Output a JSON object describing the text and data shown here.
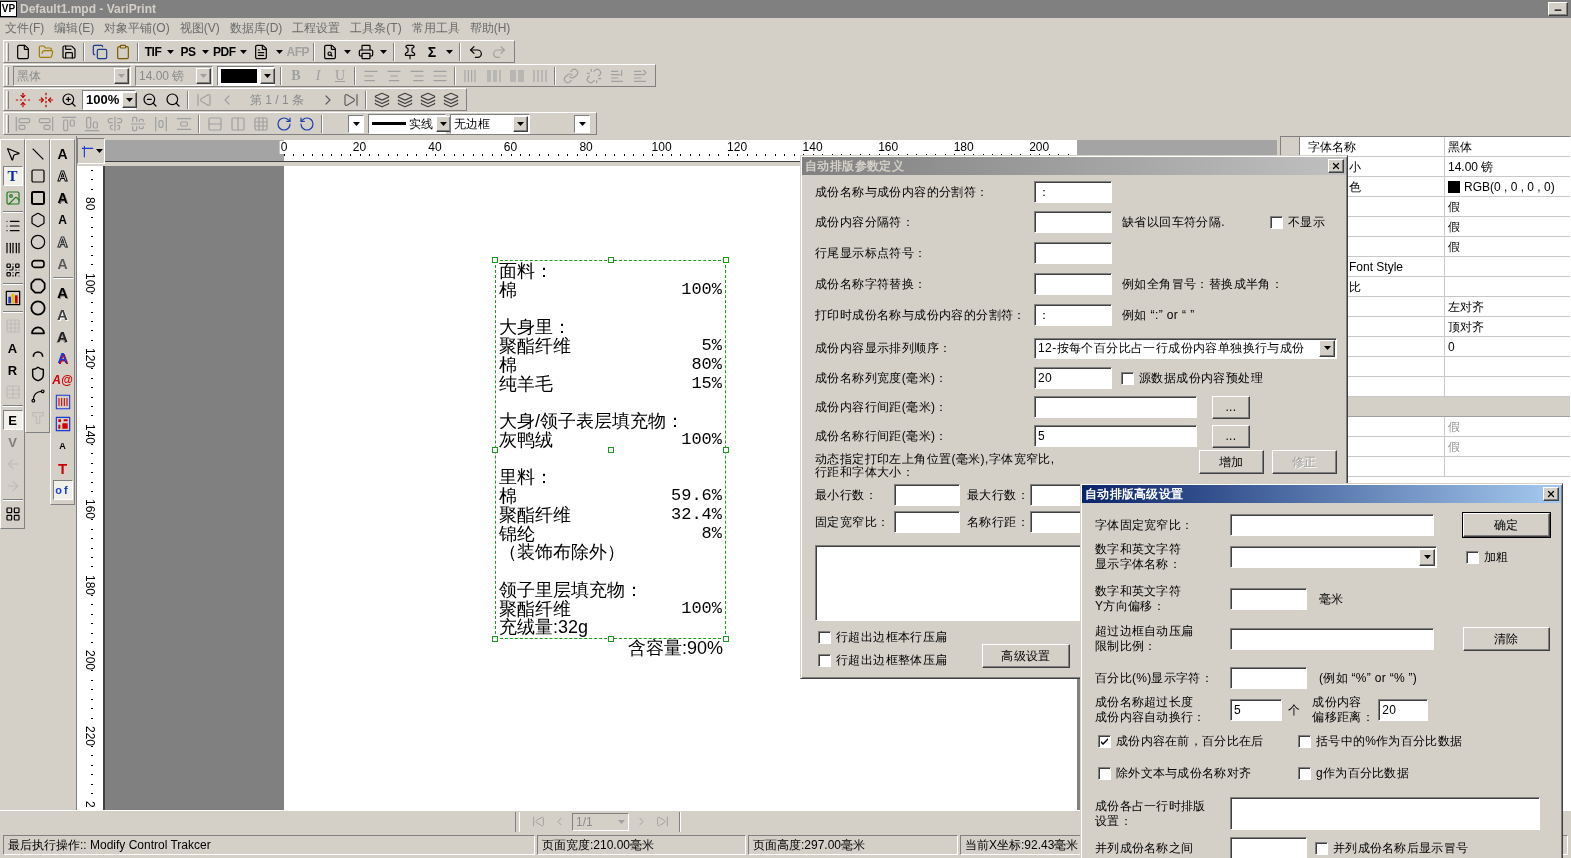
{
  "window": {
    "badge": "VP",
    "title": "Default1.mpd - VariPrint"
  },
  "menu": [
    "文件(F)",
    "编辑(E)",
    "对象平铺(O)",
    "视图(V)",
    "数据库(D)",
    "工程设置",
    "工具条(T)",
    "常用工具",
    "帮助(H)"
  ],
  "toolbars": [
    [
      [
        {
          "kind": "icon",
          "disabled": false
        },
        {
          "kind": "icon",
          "disabled": false
        },
        {
          "kind": "icon",
          "disabled": false
        }
      ],
      [
        {
          "kind": "icon",
          "disabled": false
        },
        {
          "kind": "icon",
          "disabled": false
        }
      ],
      [
        {
          "kind": "label",
          "text": "TIF",
          "disabled": false
        },
        {
          "kind": "caret",
          "disabled": false
        },
        {
          "kind": "label",
          "text": "PS",
          "disabled": false
        },
        {
          "kind": "caret",
          "disabled": false
        },
        {
          "kind": "label",
          "text": "PDF",
          "disabled": false
        },
        {
          "kind": "caret",
          "disabled": false
        },
        {
          "kind": "icon",
          "disabled": false
        },
        {
          "kind": "caret",
          "disabled": false
        },
        {
          "kind": "label",
          "text": "AFP",
          "disabled": true
        }
      ],
      [
        {
          "kind": "icon",
          "disabled": false
        },
        {
          "kind": "caret",
          "disabled": false
        },
        {
          "kind": "icon",
          "disabled": false
        },
        {
          "kind": "caret",
          "disabled": false
        }
      ],
      [
        {
          "kind": "icon",
          "disabled": false
        },
        {
          "kind": "label",
          "text": "Σ",
          "disabled": false
        },
        {
          "kind": "caret",
          "disabled": false
        }
      ],
      [
        {
          "kind": "icon",
          "disabled": false
        },
        {
          "kind": "icon",
          "disabled": true
        }
      ]
    ],
    [
      [
        {
          "kind": "combo",
          "value": "黑体",
          "disabled": true
        },
        {
          "kind": "combo",
          "value": "14.00 镑",
          "disabled": true
        },
        {
          "kind": "color_combo",
          "color": "#000000",
          "disabled": false
        }
      ],
      [
        {
          "kind": "label",
          "text": "B",
          "disabled": true
        },
        {
          "kind": "label",
          "text": "I",
          "disabled": true
        },
        {
          "kind": "label",
          "text": "U",
          "disabled": true
        }
      ],
      [
        {
          "kind": "icon",
          "disabled": true
        },
        {
          "kind": "icon",
          "disabled": true
        },
        {
          "kind": "icon",
          "disabled": true
        },
        {
          "kind": "icon",
          "disabled": true
        }
      ],
      [
        {
          "kind": "icon",
          "disabled": true
        },
        {
          "kind": "icon",
          "disabled": true
        },
        {
          "kind": "icon",
          "disabled": true
        },
        {
          "kind": "icon",
          "disabled": true
        }
      ],
      [
        {
          "kind": "icon",
          "disabled": true
        },
        {
          "kind": "icon",
          "disabled": true
        },
        {
          "kind": "icon",
          "disabled": true
        },
        {
          "kind": "icon",
          "disabled": true
        }
      ]
    ],
    [
      [
        {
          "kind": "icon",
          "disabled": false
        },
        {
          "kind": "icon",
          "disabled": false
        },
        {
          "kind": "icon",
          "disabled": false
        },
        {
          "kind": "combo",
          "value": "100%",
          "disabled": false
        },
        {
          "kind": "icon",
          "disabled": false
        },
        {
          "kind": "icon",
          "disabled": false
        }
      ],
      [
        {
          "kind": "icon",
          "disabled": true
        },
        {
          "kind": "icon",
          "disabled": true
        },
        {
          "kind": "text",
          "text": "第 1 / 1 条",
          "disabled": true
        },
        {
          "kind": "icon",
          "disabled": false
        },
        {
          "kind": "icon",
          "disabled": false
        }
      ],
      [
        {
          "kind": "icon",
          "disabled": false
        },
        {
          "kind": "icon",
          "disabled": false
        },
        {
          "kind": "icon",
          "disabled": false
        },
        {
          "kind": "icon",
          "disabled": false
        }
      ]
    ],
    [
      [
        {
          "kind": "icon",
          "disabled": true
        },
        {
          "kind": "icon",
          "disabled": true
        },
        {
          "kind": "icon",
          "disabled": true
        },
        {
          "kind": "icon",
          "disabled": true
        },
        {
          "kind": "icon",
          "disabled": true
        },
        {
          "kind": "icon",
          "disabled": true
        },
        {
          "kind": "icon",
          "disabled": true
        },
        {
          "kind": "icon",
          "disabled": true
        }
      ],
      [
        {
          "kind": "icon",
          "disabled": true
        },
        {
          "kind": "icon",
          "disabled": true
        },
        {
          "kind": "icon",
          "disabled": true
        },
        {
          "kind": "icon",
          "disabled": false
        },
        {
          "kind": "icon",
          "disabled": false
        }
      ],
      [
        {
          "kind": "combo",
          "disabled": false
        },
        {
          "kind": "line_combo",
          "value": "实线",
          "disabled": false
        },
        {
          "kind": "combo",
          "value": "无边框",
          "disabled": false
        },
        {
          "kind": "combo",
          "disabled": false
        }
      ]
    ]
  ],
  "tool_palettes": [
    [
      [
        {
          "kind": "icon",
          "selected": false,
          "disabled": false
        },
        {
          "kind": "glyph",
          "text": "T",
          "selected": true,
          "disabled": false
        },
        {
          "kind": "icon",
          "selected": false,
          "disabled": false
        }
      ],
      [
        {
          "kind": "icon",
          "selected": false,
          "disabled": false
        },
        {
          "kind": "icon",
          "selected": false,
          "disabled": false
        },
        {
          "kind": "icon",
          "selected": false,
          "disabled": false
        }
      ],
      [
        {
          "kind": "icon",
          "selected": false,
          "disabled": false
        }
      ],
      [
        {
          "kind": "icon",
          "selected": false,
          "disabled": true
        },
        {
          "kind": "glyph",
          "text": "A",
          "selected": false,
          "disabled": false
        },
        {
          "kind": "glyph",
          "text": "R",
          "selected": false,
          "disabled": false
        },
        {
          "kind": "icon",
          "selected": false,
          "disabled": true
        }
      ],
      [
        {
          "kind": "glyph",
          "text": "E",
          "selected": true,
          "disabled": false
        },
        {
          "kind": "glyph",
          "text": "V",
          "selected": false,
          "disabled": true
        },
        {
          "kind": "icon",
          "selected": false,
          "disabled": true
        },
        {
          "kind": "icon",
          "selected": false,
          "disabled": true
        }
      ],
      [
        {
          "kind": "icon",
          "selected": false,
          "disabled": false
        }
      ]
    ],
    [
      [
        {
          "kind": "icon",
          "selected": false,
          "disabled": false
        },
        {
          "kind": "icon",
          "selected": false,
          "disabled": false
        },
        {
          "kind": "icon",
          "selected": false,
          "disabled": false
        },
        {
          "kind": "icon",
          "selected": false,
          "disabled": false
        },
        {
          "kind": "icon",
          "selected": false,
          "disabled": false
        },
        {
          "kind": "icon",
          "selected": false,
          "disabled": false
        },
        {
          "kind": "icon",
          "selected": false,
          "disabled": false
        },
        {
          "kind": "icon",
          "selected": false,
          "disabled": false
        },
        {
          "kind": "icon",
          "selected": false,
          "disabled": false
        },
        {
          "kind": "icon",
          "selected": false,
          "disabled": false
        },
        {
          "kind": "icon",
          "selected": false,
          "disabled": false
        },
        {
          "kind": "icon",
          "selected": false,
          "disabled": false
        },
        {
          "kind": "icon",
          "selected": false,
          "disabled": true
        }
      ]
    ],
    [
      [
        {
          "kind": "glyph",
          "text": "A",
          "selected": false,
          "disabled": false
        },
        {
          "kind": "glyph",
          "text": "A",
          "selected": false,
          "disabled": false
        },
        {
          "kind": "glyph",
          "text": "A",
          "selected": false,
          "disabled": false
        },
        {
          "kind": "glyph",
          "text": "A",
          "selected": false,
          "disabled": false
        },
        {
          "kind": "glyph",
          "text": "A",
          "selected": false,
          "disabled": false
        },
        {
          "kind": "glyph",
          "text": "A",
          "selected": false,
          "disabled": false
        }
      ],
      [
        {
          "kind": "glyph",
          "text": "A",
          "selected": false,
          "disabled": false
        },
        {
          "kind": "glyph",
          "text": "A",
          "selected": false,
          "disabled": false
        },
        {
          "kind": "glyph",
          "text": "A",
          "selected": false,
          "disabled": false
        },
        {
          "kind": "glyph",
          "text": "A",
          "selected": false,
          "disabled": false
        },
        {
          "kind": "glyph",
          "text": "A@",
          "selected": false,
          "disabled": false
        },
        {
          "kind": "icon",
          "selected": false,
          "disabled": false
        },
        {
          "kind": "icon",
          "selected": false,
          "disabled": false
        },
        {
          "kind": "glyph",
          "text": "A",
          "selected": false,
          "disabled": false
        },
        {
          "kind": "glyph",
          "text": "T",
          "selected": false,
          "disabled": false
        },
        {
          "kind": "glyph",
          "text": "of",
          "selected": true,
          "disabled": false
        }
      ]
    ]
  ],
  "rulers": {
    "horizontal": [
      "0",
      "20",
      "40",
      "60",
      "80",
      "100",
      "120",
      "140",
      "160",
      "180",
      "200"
    ],
    "vertical": [
      "80",
      "100",
      "120",
      "140",
      "160",
      "180",
      "200",
      "220",
      "2"
    ]
  },
  "label_frame": {
    "selected": true,
    "groups": [
      {
        "heading": "面料：",
        "items": [
          {
            "name": "棉",
            "value": "100%"
          }
        ]
      },
      {
        "heading": "大身里：",
        "items": [
          {
            "name": "聚酯纤维",
            "value": "5%"
          },
          {
            "name": "棉",
            "value": "80%"
          },
          {
            "name": "纯羊毛",
            "value": "15%"
          }
        ]
      },
      {
        "heading": "大身/领子表层填充物：",
        "items": [
          {
            "name": "灰鸭绒",
            "value": "100%"
          }
        ]
      },
      {
        "heading": "里料：",
        "items": [
          {
            "name": "棉",
            "value": "59.6%"
          },
          {
            "name": "聚酯纤维",
            "value": "32.4%"
          },
          {
            "name": "锦纶",
            "value": "8%"
          },
          {
            "name": "（装饰布除外）"
          }
        ]
      },
      {
        "heading": "领子里层填充物：",
        "items": [
          {
            "name": "聚酯纤维",
            "value": "100%"
          },
          {
            "name": "充绒量:32g"
          }
        ]
      }
    ],
    "footer": "含容量:90%"
  },
  "properties": [
    {
      "kind": "text",
      "label": "字体名称",
      "value": "黑体",
      "disabled": false
    },
    {
      "kind": "text",
      "label": "小",
      "value": "14.00 镑",
      "disabled": false
    },
    {
      "kind": "color",
      "label": "色",
      "value": "RGB(0 , 0 , 0 , 0)",
      "color": "#000000",
      "disabled": false
    },
    {
      "kind": "text",
      "value": "假",
      "disabled": false
    },
    {
      "kind": "text",
      "value": "假",
      "disabled": false
    },
    {
      "kind": "text",
      "value": "假",
      "disabled": false
    },
    {
      "kind": "text",
      "label": "Font Style",
      "disabled": false
    },
    {
      "kind": "text",
      "label": "比",
      "disabled": false
    },
    {
      "kind": "text",
      "value": "左对齐",
      "disabled": false
    },
    {
      "kind": "text",
      "value": "顶对齐",
      "disabled": false
    },
    {
      "kind": "text",
      "value": "0",
      "disabled": false
    },
    {
      "kind": "blank"
    },
    {
      "kind": "blank"
    },
    {
      "kind": "section"
    },
    {
      "kind": "text",
      "value": "假",
      "disabled": true
    },
    {
      "kind": "text",
      "value": "假",
      "disabled": true
    },
    {
      "kind": "blank"
    }
  ],
  "params_dialog": {
    "title": "自动排版参数定义",
    "active": false,
    "rows": [
      {
        "kind": "input",
        "label": "成份名称与成份内容的分割符：",
        "value": "："
      },
      {
        "kind": "input",
        "label": "成份内容分隔符：",
        "note": "缺省以回车符分隔.",
        "checkbox": {
          "label": "不显示",
          "checked": false
        }
      },
      {
        "kind": "input",
        "label": "行尾显示标点符号："
      },
      {
        "kind": "input",
        "label": "成份名称字符替换：",
        "note": "例如全角冒号：替换成半角："
      },
      {
        "kind": "input",
        "label": "打印时成份名称与成份内容的分割符：",
        "value": "：",
        "note": "例如 “:” or “ ”"
      },
      {
        "kind": "select",
        "label": "成份内容显示排列顺序：",
        "value": "12-按每个百分比占一行成份内容单独换行与成份"
      },
      {
        "kind": "input",
        "label": "成份名称列宽度(毫米)：",
        "value": "20",
        "checkbox": {
          "label": "源数据成份内容预处理",
          "checked": false
        }
      },
      {
        "kind": "wide_input",
        "label": "成份内容行间距(毫米)：",
        "button": "..."
      },
      {
        "kind": "wide_input",
        "label": "成份名称行间距(毫米)：",
        "value": "5",
        "button": "..."
      }
    ],
    "dynamic": {
      "lines": [
        "动态指定打印左上角位置(毫米),字体宽窄比,",
        "行距和字体大小："
      ],
      "buttons": [
        {
          "label": "增加",
          "disabled": false
        },
        {
          "label": "修正",
          "disabled": true
        }
      ]
    },
    "limits": [
      [
        "最小行数：",
        "最大行数："
      ],
      [
        "固定宽窄比：",
        "名称行距："
      ]
    ],
    "checkboxes": [
      {
        "label": "行超出边框本行压扁",
        "checked": false
      },
      {
        "label": "行超出边框整体压扁",
        "checked": false
      }
    ],
    "advanced_button": "高级设置"
  },
  "advanced_dialog": {
    "title": "自动排版高级设置",
    "active": true,
    "rows": [
      {
        "kind": "wide_input",
        "label": [
          "字体固定宽窄比："
        ],
        "button": {
          "label": "确定",
          "default": true
        }
      },
      {
        "kind": "select",
        "label": [
          "数字和英文字符",
          "显示字体名称："
        ],
        "checkbox": {
          "label": "加粗",
          "checked": false
        }
      },
      {
        "kind": "short_input",
        "label": [
          "数字和英文字符",
          "Y方向偏移："
        ],
        "unit": "毫米"
      },
      {
        "kind": "wide_input",
        "label": [
          "超过边框自动压扁",
          "限制比例："
        ],
        "button": {
          "label": "清除",
          "default": false
        }
      },
      {
        "kind": "short_input",
        "label": [
          "百分比(%)显示字符："
        ],
        "unit": "(例如 “%” or “% ”)"
      },
      {
        "kind": "pair_input",
        "label": [
          "成份名称超过长度",
          "成份内容自动换行："
        ],
        "value": "5",
        "unit": "个",
        "label_2": [
          "成份内容",
          "偏移距离："
        ],
        "value_2": "20"
      },
      {
        "kind": "checks",
        "items": [
          {
            "label": "成份内容在前，百分比在后",
            "checked": true
          },
          {
            "label": "括号中的%作为百分比数据",
            "checked": false
          }
        ]
      },
      {
        "kind": "checks",
        "items": [
          {
            "label": "除外文本与成份名称对齐",
            "checked": false
          },
          {
            "label": "g作为百分比数据",
            "checked": false
          }
        ]
      },
      {
        "kind": "textarea",
        "label": [
          "成份各占一行时排版",
          "设置："
        ]
      },
      {
        "kind": "short_input",
        "label": [
          "并列成份名称之间"
        ],
        "checkbox": {
          "label": "并列成份名称后显示冒号",
          "checked": false
        }
      }
    ]
  },
  "page_nav": {
    "page": {
      "value": "1/1",
      "disabled": true
    },
    "buttons": [
      {
        "disabled": true
      },
      {
        "disabled": true
      },
      {
        "disabled": true
      },
      {
        "disabled": true
      }
    ]
  },
  "status_bar": [
    "最后执行操作:: Modify Control Trakcer",
    "页面宽度:210.00毫米",
    "页面高度:297.00毫米",
    "当前X坐标:92.43毫米"
  ]
}
